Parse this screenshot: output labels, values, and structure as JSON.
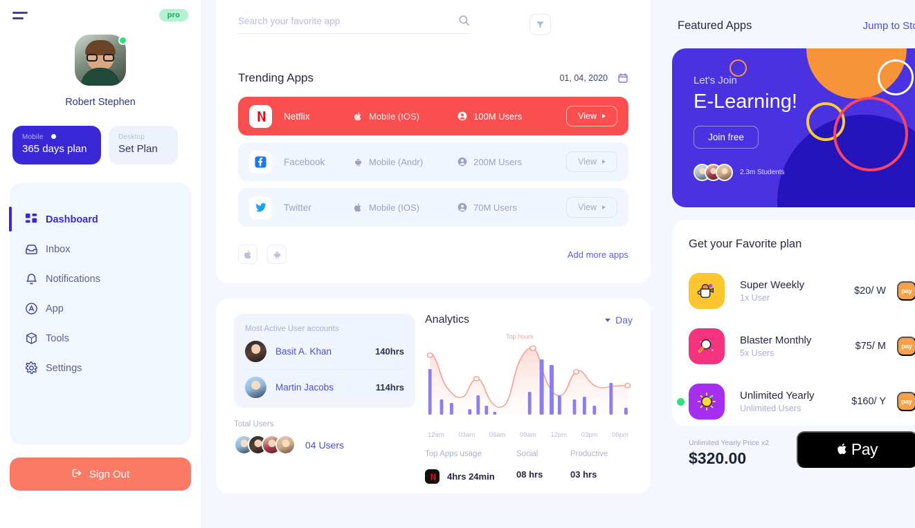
{
  "sidebar": {
    "menu_icon": "hamburger-icon",
    "pro_badge": "pro",
    "profile": {
      "name": "Robert Stephen",
      "status": "online"
    },
    "plans": [
      {
        "label": "Mobile",
        "value": "365 days plan",
        "active": true
      },
      {
        "label": "Desktop",
        "value": "Set Plan",
        "active": false
      }
    ],
    "nav": [
      {
        "label": "Dashboard",
        "icon": "grid-icon",
        "active": true
      },
      {
        "label": "Inbox",
        "icon": "inbox-icon",
        "active": false
      },
      {
        "label": "Notifications",
        "icon": "bell-icon",
        "active": false
      },
      {
        "label": "App",
        "icon": "app-circle-icon",
        "active": false
      },
      {
        "label": "Tools",
        "icon": "cube-icon",
        "active": false
      },
      {
        "label": "Settings",
        "icon": "gear-icon",
        "active": false
      }
    ],
    "signout_label": "Sign Out",
    "signout_icon": "logout-icon",
    "accent_active": "#3a28d6",
    "signout_color": "#fa7a65"
  },
  "main": {
    "search": {
      "placeholder": "Search your favorite app",
      "value": "",
      "icon": "search-icon"
    },
    "filter_icon": "filter-icon",
    "trending": {
      "title": "Trending Apps",
      "date": "01, 04, 2020",
      "calendar_icon": "calendar-icon",
      "apps": [
        {
          "name": "Netflix",
          "platform": "Mobile (IOS)",
          "platform_icon": "apple-icon",
          "users": "100M Users",
          "users_icon": "person-icon",
          "view_label": "View",
          "featured": true
        },
        {
          "name": "Facebook",
          "platform": "Mobile (Andr)",
          "platform_icon": "android-icon",
          "users": "200M Users",
          "users_icon": "person-icon",
          "view_label": "View",
          "featured": false
        },
        {
          "name": "Twitter",
          "platform": "Mobile (IOS)",
          "platform_icon": "apple-icon",
          "users": "70M Users",
          "users_icon": "person-icon",
          "view_label": "View",
          "featured": false
        }
      ],
      "os_chips": [
        "apple-icon",
        "android-icon"
      ],
      "add_more_label": "Add more apps"
    },
    "active_users": {
      "heading": "Most Active User accounts",
      "rows": [
        {
          "name": "Basit A. Khan",
          "hours": "140hrs"
        },
        {
          "name": "Martin Jacobs",
          "hours": "114hrs"
        }
      ]
    },
    "total_users": {
      "label": "Total Users",
      "count": "04 Users",
      "avatar_count": 4
    },
    "analytics": {
      "title": "Analytics",
      "range_label": "Day",
      "range_icon": "chevron-down-icon",
      "peak_label": "Top hours"
    },
    "stats": [
      {
        "head": "Top Apps usage",
        "value": "4hrs 24min",
        "icon": "netflix-icon"
      },
      {
        "head": "Social",
        "value": "08 hrs",
        "icon": ""
      },
      {
        "head": "Productive",
        "value": "03 hrs",
        "icon": ""
      }
    ]
  },
  "right": {
    "header": {
      "title": "Featured Apps",
      "link": "Jump to Store"
    },
    "banner": {
      "subtitle": "Let's Join",
      "title": "E-Learning!",
      "cta": "Join free",
      "students": "2.3m Students",
      "bg": "#4a32e0"
    },
    "plan_panel": {
      "title": "Get your Favorite plan",
      "plans": [
        {
          "name": "Super Weekly",
          "users": "1x User",
          "price": "$20/ W",
          "pay_label": "pay",
          "icon": "watering-can-icon",
          "icon_bg": "#fdc62e",
          "selected": false
        },
        {
          "name": "Blaster Monthly",
          "users": "5x Users",
          "price": "$75/ M",
          "pay_label": "pay",
          "icon": "magnifier-icon",
          "icon_bg": "#f5327d",
          "selected": false
        },
        {
          "name": "Unlimited Yearly",
          "users": "Unlimited Users",
          "price": "$160/ Y",
          "pay_label": "pay",
          "icon": "sun-icon",
          "icon_bg": "#a62ef0",
          "selected": true
        }
      ]
    },
    "checkout": {
      "label": "Unlimited Yearly Price x2",
      "amount": "$320.00",
      "button_label": "Pay",
      "button_icon": "apple-icon"
    }
  },
  "chart_data": {
    "type": "bar",
    "title": "Analytics",
    "xlabel": "",
    "ylabel": "",
    "grid": false,
    "legend": false,
    "annotations": [
      {
        "text": "Top hours",
        "x": "10am"
      }
    ],
    "tick_labels": [
      "12am",
      "03am",
      "06am",
      "09am",
      "12pm",
      "03pm",
      "06pm"
    ],
    "x": [
      "12am",
      "01am",
      "02am",
      "03am",
      "04am",
      "05am",
      "06am",
      "07am",
      "08am",
      "09am",
      "10am",
      "11am",
      "12pm",
      "01pm",
      "02pm",
      "03pm",
      "04pm",
      "05pm",
      "06pm"
    ],
    "series": [
      {
        "name": "Usage bars",
        "type": "bar",
        "color": "#8a7ef0",
        "values": [
          78,
          26,
          20,
          6,
          34,
          14,
          4,
          0,
          0,
          40,
          96,
          82,
          30,
          24,
          30,
          14,
          0,
          46,
          12
        ]
      },
      {
        "name": "Trend curve",
        "type": "line",
        "color": "#f5a091",
        "fill": "#fde5e0",
        "values": [
          88,
          60,
          30,
          42,
          34,
          18,
          10,
          22,
          52,
          84,
          100,
          78,
          48,
          32,
          40,
          68,
          58,
          44,
          46
        ]
      }
    ],
    "ylim": [
      0,
      100
    ]
  }
}
